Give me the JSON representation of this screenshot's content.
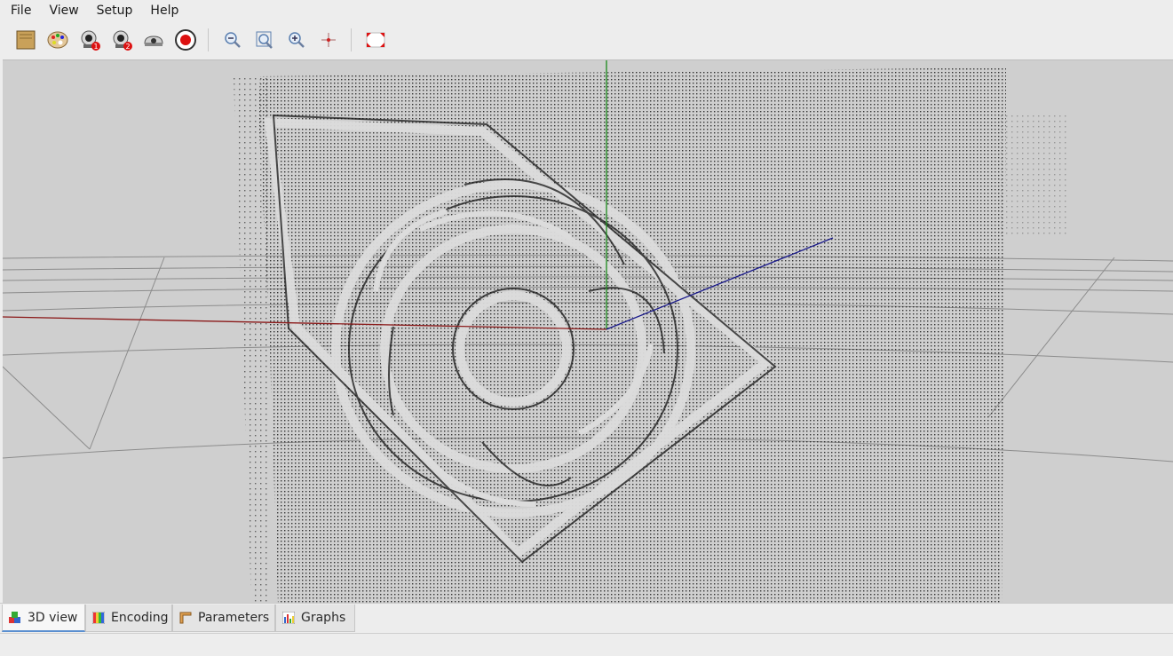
{
  "menu": {
    "file": "File",
    "view": "View",
    "setup": "Setup",
    "help": "Help"
  },
  "toolbar": {
    "icons": [
      "open-map-icon",
      "palette-icon",
      "camera-1-icon",
      "camera-2-icon",
      "projector-icon",
      "record-icon",
      "zoom-out-icon",
      "zoom-fit-icon",
      "zoom-in-icon",
      "center-icon",
      "frame-icon"
    ]
  },
  "tabs": [
    {
      "label": "3D view",
      "active": true
    },
    {
      "label": "Encoding",
      "active": false
    },
    {
      "label": "Parameters",
      "active": false
    },
    {
      "label": "Graphs",
      "active": false
    }
  ],
  "colors": {
    "x_axis": "#8b1a1a",
    "y_axis": "#1a8b1a",
    "z_axis": "#1a1a8b",
    "points": "#111111",
    "background": "#cfcfcf"
  }
}
